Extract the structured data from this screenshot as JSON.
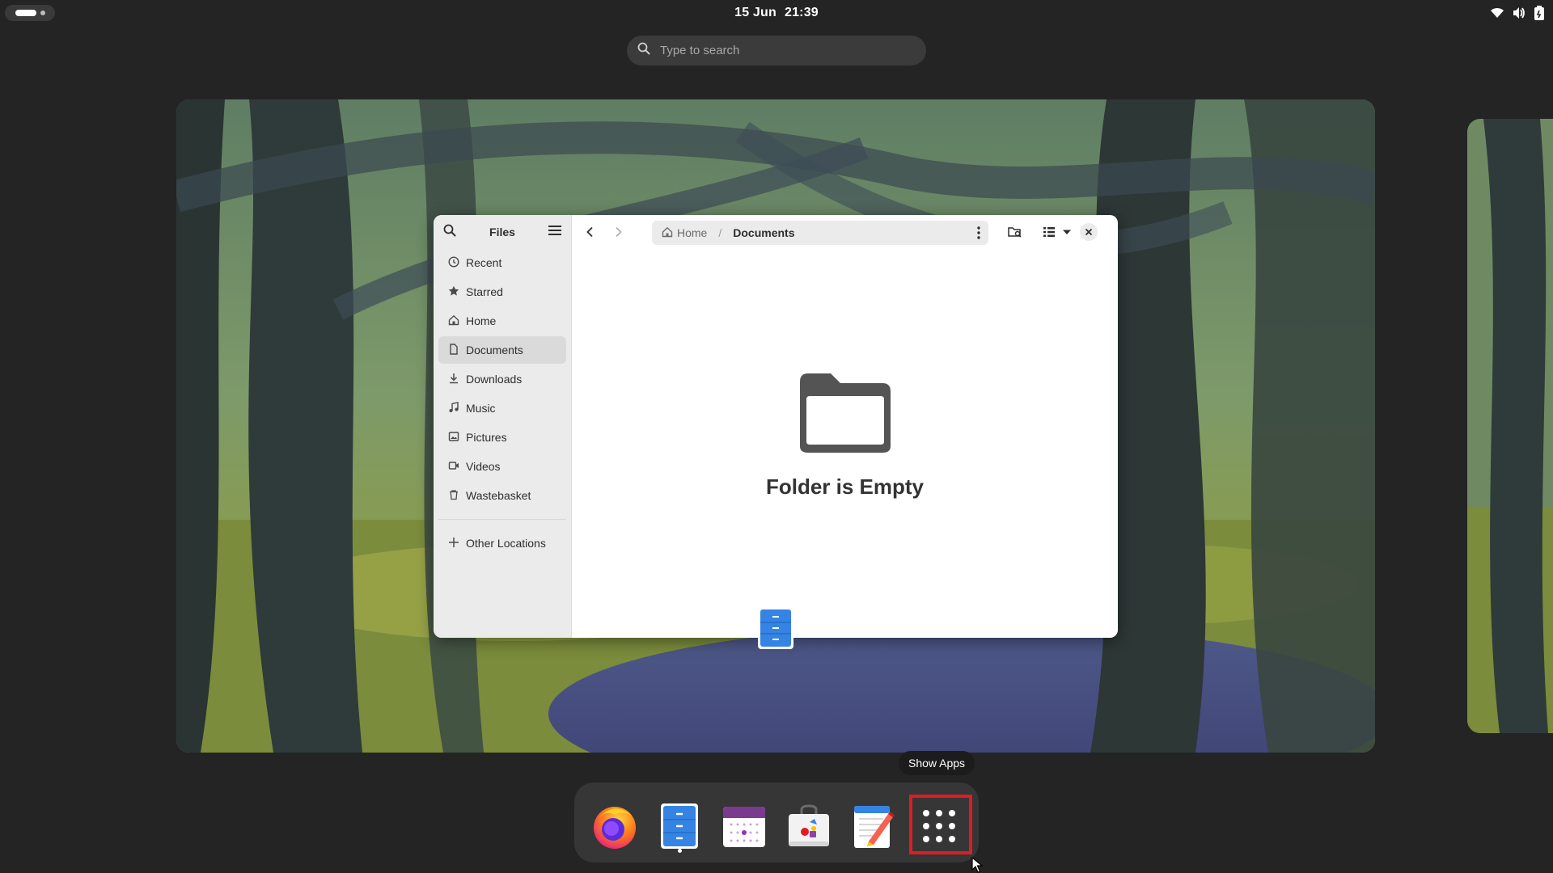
{
  "topbar": {
    "date": "15 Jun",
    "time": "21:39",
    "tray_icons": [
      "wifi-icon",
      "volume-icon",
      "battery-icon"
    ]
  },
  "search": {
    "placeholder": "Type to search"
  },
  "files_window": {
    "title": "Files",
    "sidebar": {
      "items": [
        {
          "label": "Recent",
          "icon": "clock-icon"
        },
        {
          "label": "Starred",
          "icon": "star-icon"
        },
        {
          "label": "Home",
          "icon": "home-icon"
        },
        {
          "label": "Documents",
          "icon": "document-icon",
          "active": true
        },
        {
          "label": "Downloads",
          "icon": "download-icon"
        },
        {
          "label": "Music",
          "icon": "music-icon"
        },
        {
          "label": "Pictures",
          "icon": "picture-icon"
        },
        {
          "label": "Videos",
          "icon": "video-icon"
        },
        {
          "label": "Wastebasket",
          "icon": "trash-icon"
        }
      ],
      "other_locations": "Other Locations"
    },
    "breadcrumb": {
      "home": "Home",
      "separator": "/",
      "current": "Documents"
    },
    "empty_state": {
      "title": "Folder is Empty"
    }
  },
  "tooltip": {
    "text": "Show Apps"
  },
  "dock": {
    "apps": [
      "firefox-icon",
      "files-icon",
      "calendar-icon",
      "software-icon",
      "text-editor-icon",
      "show-apps-icon"
    ]
  },
  "colors": {
    "background": "#242424",
    "accent": "#3584e4",
    "highlight": "#e01b24"
  }
}
